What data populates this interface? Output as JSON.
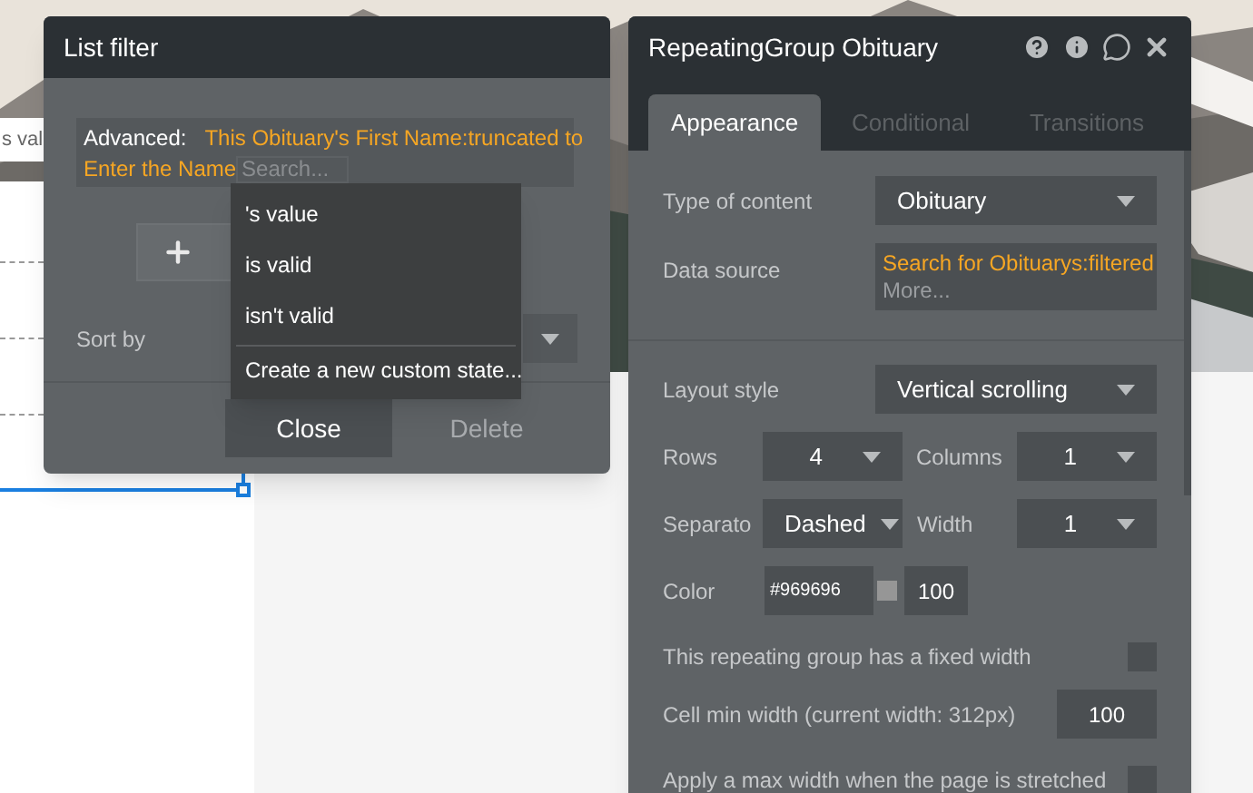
{
  "canvas": {
    "input_text": "s val"
  },
  "list_filter": {
    "title": "List filter",
    "condition": {
      "label": "Advanced:",
      "expression": "This Obituary's First Name:truncated to",
      "expression_continued": "Enter the Name",
      "search_placeholder": "Search..."
    },
    "menu": [
      {
        "label": "'s value",
        "kind": "option"
      },
      {
        "label": "is valid",
        "kind": "option"
      },
      {
        "label": "isn't valid",
        "kind": "option"
      },
      {
        "label": "Create a new custom state...",
        "kind": "action"
      }
    ],
    "sort_by_label": "Sort by",
    "buttons": [
      {
        "label": "Close",
        "disabled": false
      },
      {
        "label": "Delete",
        "disabled": true
      }
    ]
  },
  "property_editor": {
    "title": "RepeatingGroup Obituary",
    "tabs": [
      {
        "label": "Appearance",
        "selected": true
      },
      {
        "label": "Conditional",
        "selected": false
      },
      {
        "label": "Transitions",
        "selected": false
      }
    ],
    "type_of_content": {
      "label": "Type of content",
      "value": "Obituary"
    },
    "data_source": {
      "label": "Data source",
      "value": "Search for Obituarys:filtered",
      "more": "More..."
    },
    "layout_style": {
      "label": "Layout style",
      "value": "Vertical scrolling"
    },
    "rows": {
      "label": "Rows",
      "value": "4"
    },
    "columns": {
      "label": "Columns",
      "value": "1"
    },
    "separator": {
      "label": "Separato",
      "value": "Dashed"
    },
    "separator_width": {
      "label": "Width",
      "value": "1"
    },
    "color": {
      "label": "Color",
      "hex": "#969696",
      "opacity": "100"
    },
    "fixed_width": {
      "label": "This repeating group has a fixed width",
      "checked": false
    },
    "cell_min_width": {
      "label": "Cell min width (current width: 312px)",
      "value": "100"
    },
    "max_width": {
      "label": "Apply a max width when the page is stretched",
      "checked": false
    }
  }
}
